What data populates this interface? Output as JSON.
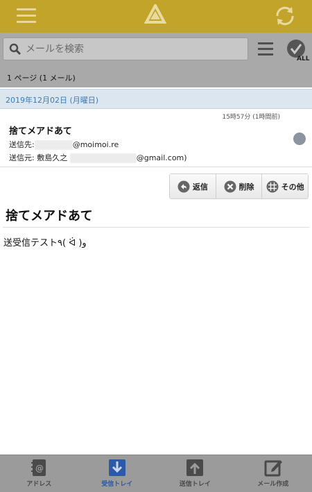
{
  "search": {
    "placeholder": "メールを検索"
  },
  "selectall": {
    "label": "ALL"
  },
  "list": {
    "summary": "1 ページ (1 メール)"
  },
  "email": {
    "date": "2019年12月02日 (月曜日)",
    "time": "15時57分 (1時間前)",
    "subject": "捨てメアドあて",
    "to_label": "送信先:",
    "to_domain": "@moimoi.re",
    "from_label": "送信元:",
    "from_name": "敷島久之",
    "from_domain": "@gmail.com)",
    "body": "送受信テスト٩( ᐛ )و"
  },
  "actions": {
    "reply": "返信",
    "delete": "削除",
    "other": "その他"
  },
  "tabs": [
    {
      "label": "アドレス"
    },
    {
      "label": "受信トレイ"
    },
    {
      "label": "送信トレイ"
    },
    {
      "label": "メール作成"
    }
  ],
  "colors": {
    "header": "#c3a42a",
    "accent_blue": "#3a7ab5",
    "date_row": "#dbe6ef",
    "active_tab": "#2a5aa8"
  }
}
